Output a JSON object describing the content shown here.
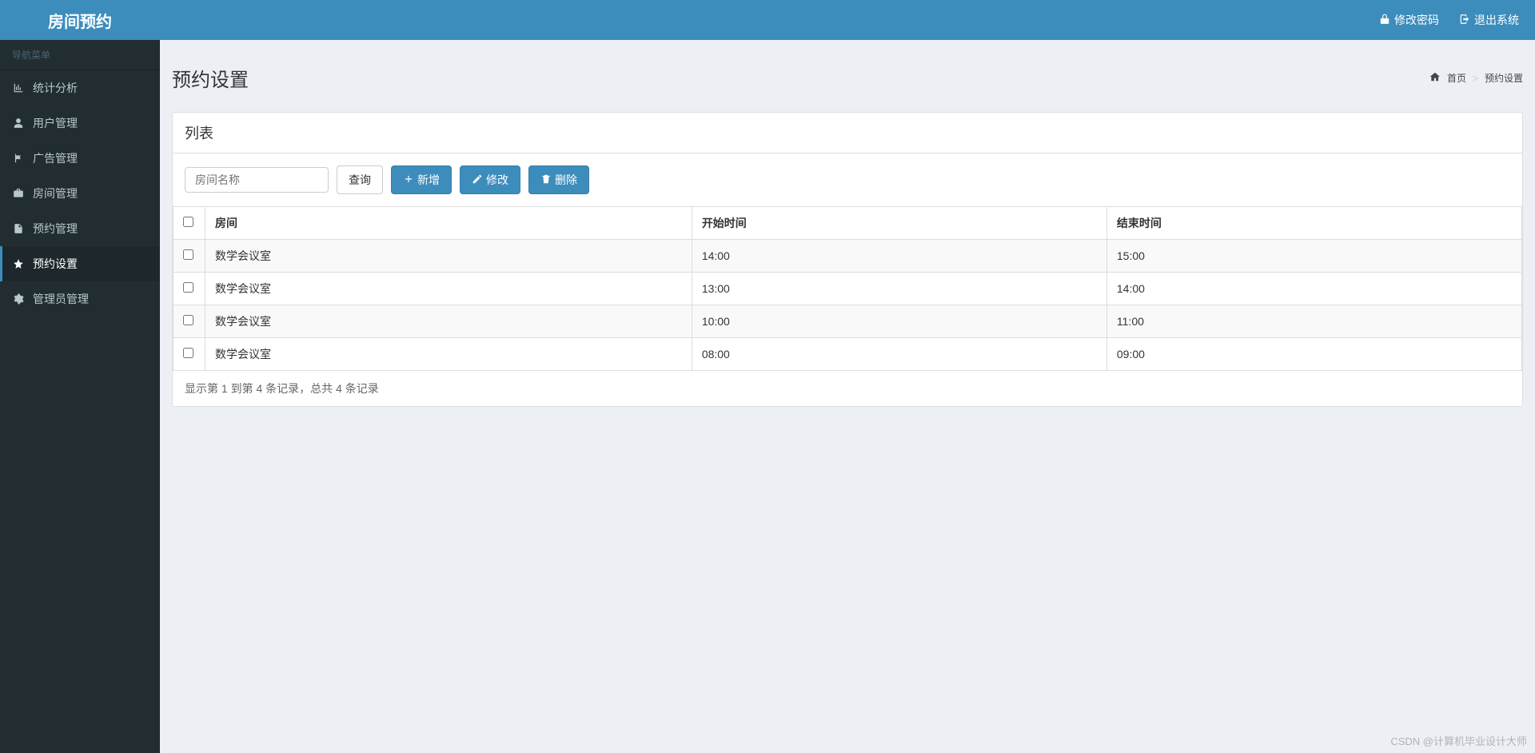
{
  "header": {
    "logo": "房间预约",
    "change_password": "修改密码",
    "logout": "退出系统"
  },
  "sidebar": {
    "title": "导航菜单",
    "items": [
      {
        "label": "统计分析",
        "icon": "bar-chart"
      },
      {
        "label": "用户管理",
        "icon": "user"
      },
      {
        "label": "广告管理",
        "icon": "flag"
      },
      {
        "label": "房间管理",
        "icon": "briefcase"
      },
      {
        "label": "预约管理",
        "icon": "file"
      },
      {
        "label": "预约设置",
        "icon": "star"
      },
      {
        "label": "管理员管理",
        "icon": "gear"
      }
    ]
  },
  "page": {
    "title": "预约设置",
    "breadcrumb_home": "首页",
    "breadcrumb_current": "预约设置"
  },
  "panel": {
    "title": "列表",
    "search_placeholder": "房间名称",
    "search_button": "查询",
    "add_button": "新增",
    "edit_button": "修改",
    "delete_button": "删除"
  },
  "table": {
    "headers": {
      "room": "房间",
      "start_time": "开始时间",
      "end_time": "结束时间"
    },
    "rows": [
      {
        "room": "数学会议室",
        "start_time": "14:00",
        "end_time": "15:00"
      },
      {
        "room": "数学会议室",
        "start_time": "13:00",
        "end_time": "14:00"
      },
      {
        "room": "数学会议室",
        "start_time": "10:00",
        "end_time": "11:00"
      },
      {
        "room": "数学会议室",
        "start_time": "08:00",
        "end_time": "09:00"
      }
    ],
    "footer": "显示第 1 到第 4 条记录，总共 4 条记录"
  },
  "watermark": "CSDN @计算机毕业设计大师"
}
